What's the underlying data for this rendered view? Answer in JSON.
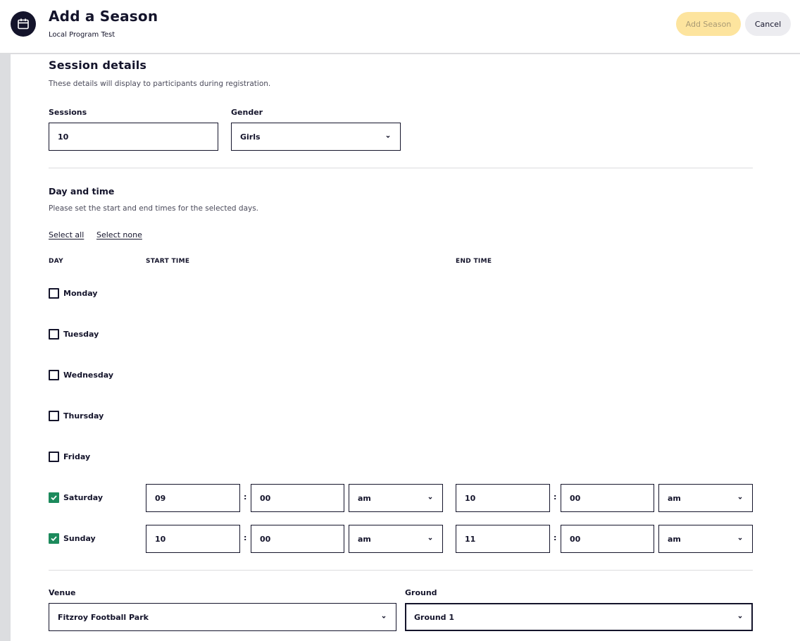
{
  "header": {
    "title": "Add a Season",
    "subtitle": "Local Program Test",
    "icon": "calendar-icon",
    "add_label": "Add Season",
    "cancel_label": "Cancel"
  },
  "session": {
    "heading": "Session details",
    "description": "These details will display to participants during registration.",
    "sessions_label": "Sessions",
    "sessions_value": "10",
    "gender_label": "Gender",
    "gender_value": "Girls"
  },
  "daytime": {
    "heading": "Day and time",
    "description": "Please set the start and end times for the selected days.",
    "select_all": "Select all",
    "select_none": "Select none",
    "col_day": "DAY",
    "col_start": "START TIME",
    "col_end": "END TIME",
    "days": [
      {
        "name": "Monday",
        "checked": false
      },
      {
        "name": "Tuesday",
        "checked": false
      },
      {
        "name": "Wednesday",
        "checked": false
      },
      {
        "name": "Thursday",
        "checked": false
      },
      {
        "name": "Friday",
        "checked": false
      },
      {
        "name": "Saturday",
        "checked": true,
        "start": {
          "hour": "09",
          "minute": "00",
          "period": "am"
        },
        "end": {
          "hour": "10",
          "minute": "00",
          "period": "am"
        }
      },
      {
        "name": "Sunday",
        "checked": true,
        "start": {
          "hour": "10",
          "minute": "00",
          "period": "am"
        },
        "end": {
          "hour": "11",
          "minute": "00",
          "period": "am"
        }
      }
    ],
    "colon": ":"
  },
  "venue": {
    "venue_label": "Venue",
    "venue_value": "Fitzroy Football Park",
    "ground_label": "Ground",
    "ground_value": "Ground 1"
  },
  "colors": {
    "primary": "#14142b",
    "checked": "#1c8a5c",
    "add_button_bg": "#fde49e",
    "cancel_button_bg": "#ececf0"
  }
}
